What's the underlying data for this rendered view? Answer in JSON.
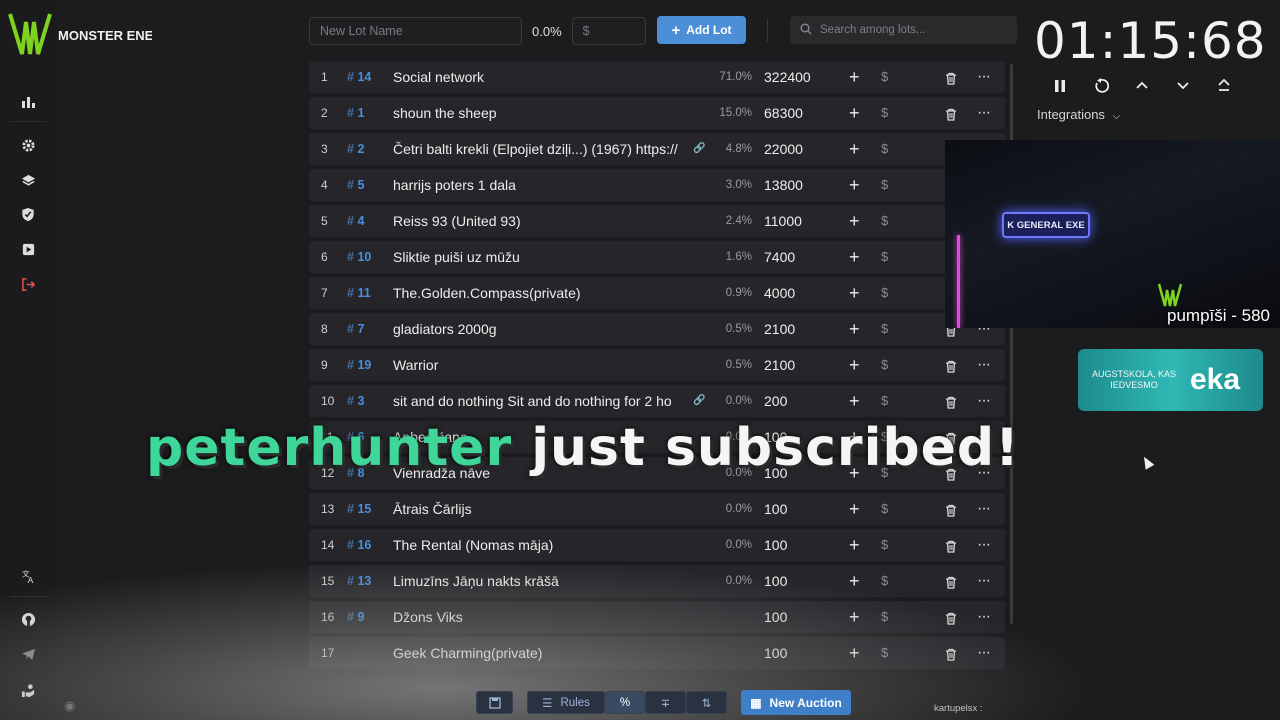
{
  "sidebar": {
    "logo_text": "MONSTER ENERGY",
    "items": [
      {
        "icon": "chart-icon"
      },
      {
        "icon": "gear-icon"
      },
      {
        "icon": "layers-icon"
      },
      {
        "icon": "shield-icon"
      },
      {
        "icon": "media-icon"
      },
      {
        "icon": "logout-icon"
      }
    ],
    "bottom_items": [
      {
        "icon": "translate-icon"
      },
      {
        "icon": "github-icon"
      },
      {
        "icon": "telegram-icon"
      },
      {
        "icon": "donate-icon"
      }
    ]
  },
  "toolbar": {
    "lot_name_placeholder": "New Lot Name",
    "percent": "0.0%",
    "amount_placeholder": "$",
    "add_label": "Add Lot",
    "search_placeholder": "Search among lots..."
  },
  "lots": [
    {
      "idx": "1",
      "id": "14",
      "name": "Social network",
      "pct": "71.0%",
      "amount": "322400",
      "link": false
    },
    {
      "idx": "2",
      "id": "1",
      "name": "shoun the sheep",
      "pct": "15.0%",
      "amount": "68300",
      "link": false
    },
    {
      "idx": "3",
      "id": "2",
      "name": "Četri balti krekli (Elpojiet dziļi...) (1967) https://",
      "pct": "4.8%",
      "amount": "22000",
      "link": true
    },
    {
      "idx": "4",
      "id": "5",
      "name": "harrijs poters 1 dala",
      "pct": "3.0%",
      "amount": "13800",
      "link": false
    },
    {
      "idx": "5",
      "id": "4",
      "name": "Reiss 93 (United 93)",
      "pct": "2.4%",
      "amount": "11000",
      "link": false
    },
    {
      "idx": "6",
      "id": "10",
      "name": "Sliktie puiši uz mūžu",
      "pct": "1.6%",
      "amount": "7400",
      "link": false
    },
    {
      "idx": "7",
      "id": "11",
      "name": "The.Golden.Compass(private)",
      "pct": "0.9%",
      "amount": "4000",
      "link": false
    },
    {
      "idx": "8",
      "id": "7",
      "name": "gladiators 2000g",
      "pct": "0.5%",
      "amount": "2100",
      "link": false
    },
    {
      "idx": "9",
      "id": "19",
      "name": "Warrior",
      "pct": "0.5%",
      "amount": "2100",
      "link": false
    },
    {
      "idx": "10",
      "id": "3",
      "name": "sit and do nothing Sit and do nothing for 2 ho",
      "pct": "0.0%",
      "amount": "200",
      "link": true
    },
    {
      "idx": "11",
      "id": "6",
      "name": "Apbedīšana",
      "pct": "0.0%",
      "amount": "100",
      "link": false
    },
    {
      "idx": "12",
      "id": "8",
      "name": "Vienradža nāve",
      "pct": "0.0%",
      "amount": "100",
      "link": false
    },
    {
      "idx": "13",
      "id": "15",
      "name": "Ātrais Čārlijs",
      "pct": "0.0%",
      "amount": "100",
      "link": false
    },
    {
      "idx": "14",
      "id": "16",
      "name": "The Rental (Nomas māja)",
      "pct": "0.0%",
      "amount": "100",
      "link": false
    },
    {
      "idx": "15",
      "id": "13",
      "name": "Limuzīns Jāņu nakts krāšā",
      "pct": "0.0%",
      "amount": "100",
      "link": false
    },
    {
      "idx": "16",
      "id": "9",
      "name": "Džons Viks",
      "pct": "",
      "amount": "100",
      "link": false
    },
    {
      "idx": "17",
      "id": "",
      "name": "Geek Charming(private)",
      "pct": "",
      "amount": "100",
      "link": false
    }
  ],
  "timer": {
    "value": "01:15:68",
    "integrations_label": "Integrations"
  },
  "overlay": {
    "cam_sign": "K GENERAL EXE",
    "cam_label": "pumpīši - 580",
    "banner_small": "AUGSTSKOLA, KAS IEDVESMO",
    "banner_big": "eka",
    "sub_user": "peterhunter",
    "sub_rest": "just subscribed!",
    "chat": [
      "kartupelsx :"
    ]
  },
  "bottom_bar": {
    "rules_label": "Rules",
    "new_auction_label": "New Auction"
  }
}
